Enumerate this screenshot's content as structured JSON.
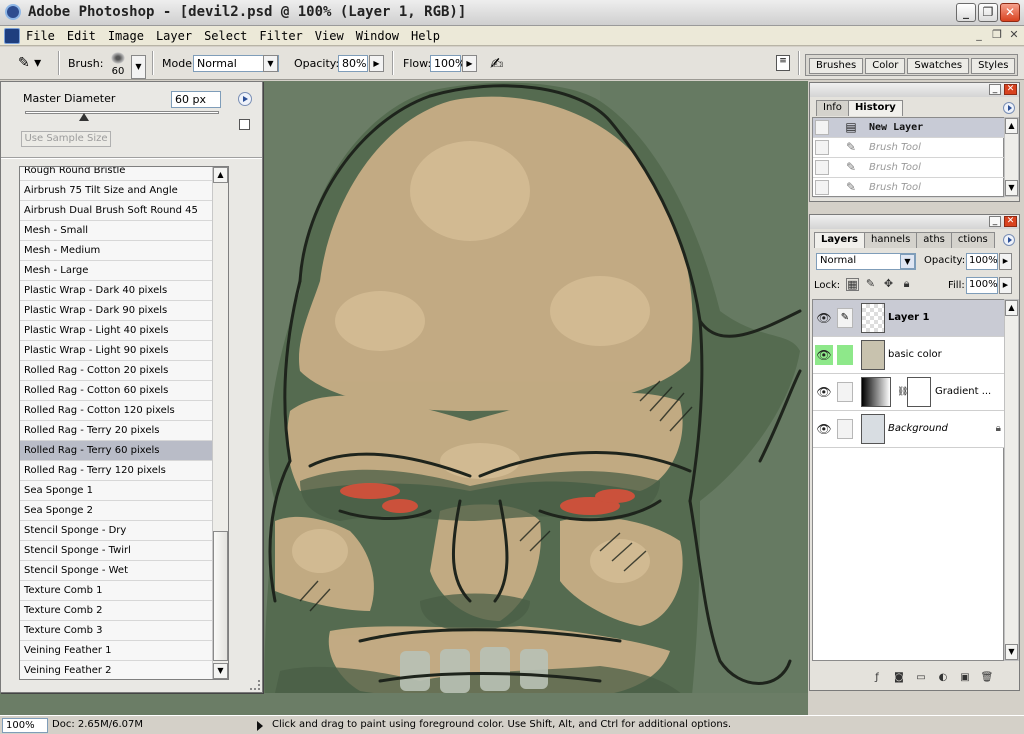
{
  "window": {
    "title": "Adobe Photoshop - [devil2.psd @ 100% (Layer 1, RGB)]"
  },
  "menu": [
    "File",
    "Edit",
    "Image",
    "Layer",
    "Select",
    "Filter",
    "View",
    "Window",
    "Help"
  ],
  "options": {
    "brush_label": "Brush:",
    "brush_size": "60",
    "mode_label": "Mode:",
    "mode_value": "Normal",
    "opacity_label": "Opacity:",
    "opacity_value": "80%",
    "flow_label": "Flow:",
    "flow_value": "100%"
  },
  "palette_well_tabs": [
    "Brushes",
    "Color",
    "Swatches",
    "Styles"
  ],
  "brush_popup": {
    "master_diameter_label": "Master Diameter",
    "master_diameter_value": "60 px",
    "sample_size_label": "Use Sample Size",
    "brushes": [
      "Rough Round Bristle",
      "Airbrush 75 Tilt Size and Angle",
      "Airbrush Dual Brush Soft Round 45",
      "Mesh - Small",
      "Mesh - Medium",
      "Mesh - Large",
      "Plastic Wrap - Dark 40 pixels",
      "Plastic Wrap - Dark 90 pixels",
      "Plastic Wrap - Light 40 pixels",
      "Plastic Wrap - Light 90 pixels",
      "Rolled Rag - Cotton 20 pixels",
      "Rolled Rag - Cotton 60 pixels",
      "Rolled Rag - Cotton 120 pixels",
      "Rolled Rag - Terry 20 pixels",
      "Rolled Rag - Terry 60 pixels",
      "Rolled Rag - Terry 120 pixels",
      "Sea Sponge 1",
      "Sea Sponge 2",
      "Stencil Sponge - Dry",
      "Stencil Sponge - Twirl",
      "Stencil Sponge - Wet",
      "Texture Comb 1",
      "Texture Comb 2",
      "Texture Comb 3",
      "Veining Feather 1",
      "Veining Feather 2"
    ],
    "selected_brush": "Rolled Rag - Terry 60 pixels"
  },
  "history_panel": {
    "tabs": [
      "Info",
      "History"
    ],
    "snapshot": "New Layer",
    "states": [
      "Brush Tool",
      "Brush Tool",
      "Brush Tool"
    ]
  },
  "layers_panel": {
    "tabs": [
      "Layers",
      "Channels",
      "Paths",
      "Actions"
    ],
    "tab_text": [
      "Layers",
      "hannels",
      "aths",
      "ctions"
    ],
    "blend_mode": "Normal",
    "opacity_label": "Opacity:",
    "opacity_value": "100%",
    "lock_label": "Lock:",
    "fill_label": "Fill:",
    "fill_value": "100%",
    "layers": [
      {
        "name": "Layer 1",
        "active": true
      },
      {
        "name": "basic color",
        "active": false
      },
      {
        "name": "Gradient ...",
        "active": false
      },
      {
        "name": "Background",
        "active": false,
        "locked": true
      }
    ]
  },
  "status": {
    "zoom": "100%",
    "doc": "Doc: 2.65M/6.07M",
    "hint": "Click and drag to paint using foreground color.  Use Shift, Alt, and Ctrl for additional options."
  },
  "colors": {
    "canvas_bg": "#6b7d66",
    "skin": "#d1b38a",
    "eyes": "#d9503a",
    "sketch": "#1e241c"
  }
}
